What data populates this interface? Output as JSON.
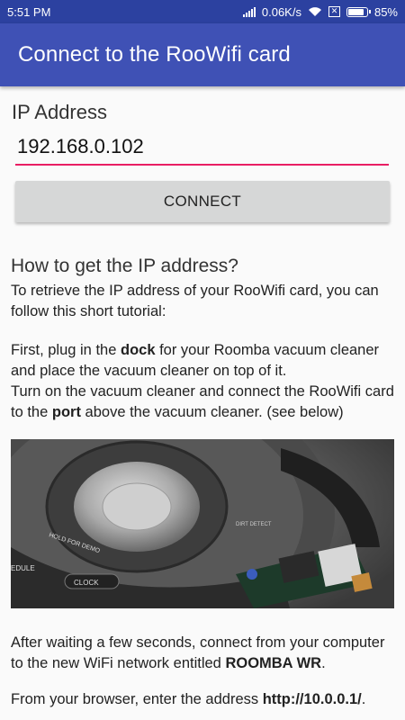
{
  "status_bar": {
    "time": "5:51 PM",
    "network_speed": "0.06K/s",
    "battery_percent": "85%",
    "battery_level": 0.85,
    "icons": [
      "signal-icon",
      "wifi-icon",
      "no-sim-icon",
      "battery-icon"
    ]
  },
  "app_bar": {
    "title": "Connect to the RooWifi card"
  },
  "form": {
    "ip_label": "IP Address",
    "ip_value": "192.168.0.102",
    "connect_label": "CONNECT"
  },
  "howto": {
    "title": "How to get the IP address?",
    "intro": "To retrieve the IP address of your RooWifi card, you can follow this short tutorial:",
    "step1": {
      "pre": "First, plug in the ",
      "bold": "dock",
      "post": " for your Roomba vacuum cleaner and place the vacuum cleaner on top of it."
    },
    "step2": {
      "pre": "Turn on the vacuum cleaner and connect the RooWifi card to the ",
      "bold": "port",
      "post": " above the vacuum cleaner. (see below)"
    },
    "photo_labels": {
      "hold": "HOLD FOR DEMO",
      "clock": "CLOCK",
      "schedule": "EDULE",
      "dirt": "DIRT DETECT"
    },
    "step3": {
      "pre": "After waiting a few seconds, connect from your computer to the new WiFi network entitled ",
      "bold": "ROOMBA WR",
      "post": "."
    },
    "step4": {
      "pre": "From your browser, enter the address ",
      "bold": "http://10.0.0.1/",
      "post": "."
    }
  },
  "colors": {
    "status_bar": "#2c41a0",
    "app_bar": "#3f51b5",
    "accent": "#e91e63",
    "button": "#d6d7d7"
  }
}
